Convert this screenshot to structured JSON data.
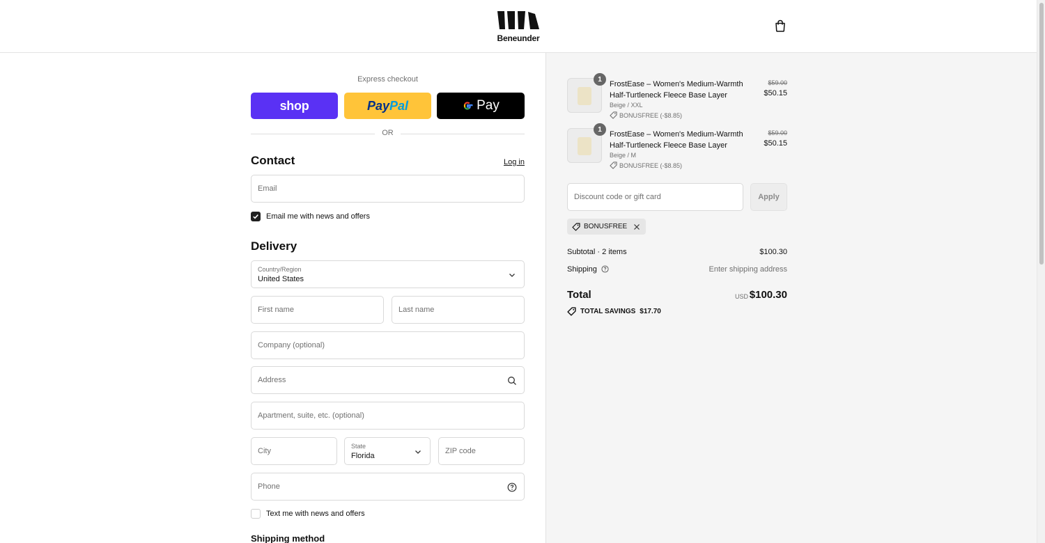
{
  "brand": {
    "name": "Beneunder"
  },
  "express": {
    "label": "Express checkout",
    "shop_label": "shop",
    "paypal_part1": "Pay",
    "paypal_part2": "Pal",
    "gpay_label": "Pay",
    "or_label": "OR"
  },
  "contact": {
    "title": "Contact",
    "login_label": "Log in",
    "email_placeholder": "Email",
    "news_label": "Email me with news and offers",
    "news_checked": true
  },
  "delivery": {
    "title": "Delivery",
    "country_label": "Country/Region",
    "country_value": "United States",
    "first_name_placeholder": "First name",
    "last_name_placeholder": "Last name",
    "company_placeholder": "Company (optional)",
    "address_placeholder": "Address",
    "apartment_placeholder": "Apartment, suite, etc. (optional)",
    "city_placeholder": "City",
    "state_label": "State",
    "state_value": "Florida",
    "zip_placeholder": "ZIP code",
    "phone_placeholder": "Phone",
    "text_label": "Text me with news and offers",
    "text_checked": false
  },
  "shipping_method": {
    "title": "Shipping method"
  },
  "summary": {
    "items": [
      {
        "qty": "1",
        "title": "FrostEase – Women's Medium-Warmth Half-Turtleneck Fleece Base Layer",
        "variant": "Beige / XXL",
        "discount": "BONUSFREE (-$8.85)",
        "old_price": "$59.00",
        "price": "$50.15"
      },
      {
        "qty": "1",
        "title": "FrostEase – Women's Medium-Warmth Half-Turtleneck Fleece Base Layer",
        "variant": "Beige / M",
        "discount": "BONUSFREE (-$8.85)",
        "old_price": "$59.00",
        "price": "$50.15"
      }
    ],
    "discount_placeholder": "Discount code or gift card",
    "apply_label": "Apply",
    "applied_code": "BONUSFREE",
    "subtotal_label": "Subtotal · 2 items",
    "subtotal_value": "$100.30",
    "shipping_label": "Shipping",
    "shipping_value": "Enter shipping address",
    "total_label": "Total",
    "currency": "USD",
    "total_value": "$100.30",
    "savings_label": "TOTAL SAVINGS",
    "savings_value": "$17.70"
  },
  "colors": {
    "shop": "#5a31f4",
    "paypal": "#ffc439",
    "gpay": "#000000",
    "summary_bg": "#f5f5f5"
  }
}
